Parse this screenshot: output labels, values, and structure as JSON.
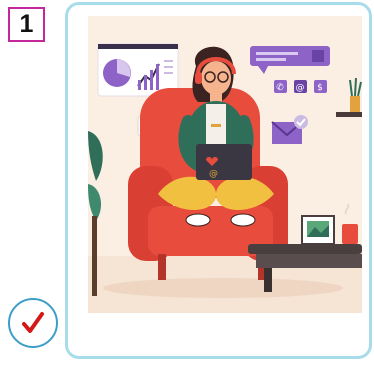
{
  "question": {
    "number": "1"
  },
  "option": {
    "image_icon": "woman-working-on-laptop-in-armchair-illustration",
    "checkmark_icon": "checkmark-icon",
    "colors": {
      "badge_border": "#c3279b",
      "card_border": "#a9dcea",
      "check_circle_border": "#3d9ec8",
      "checkmark": "#d31818"
    }
  }
}
